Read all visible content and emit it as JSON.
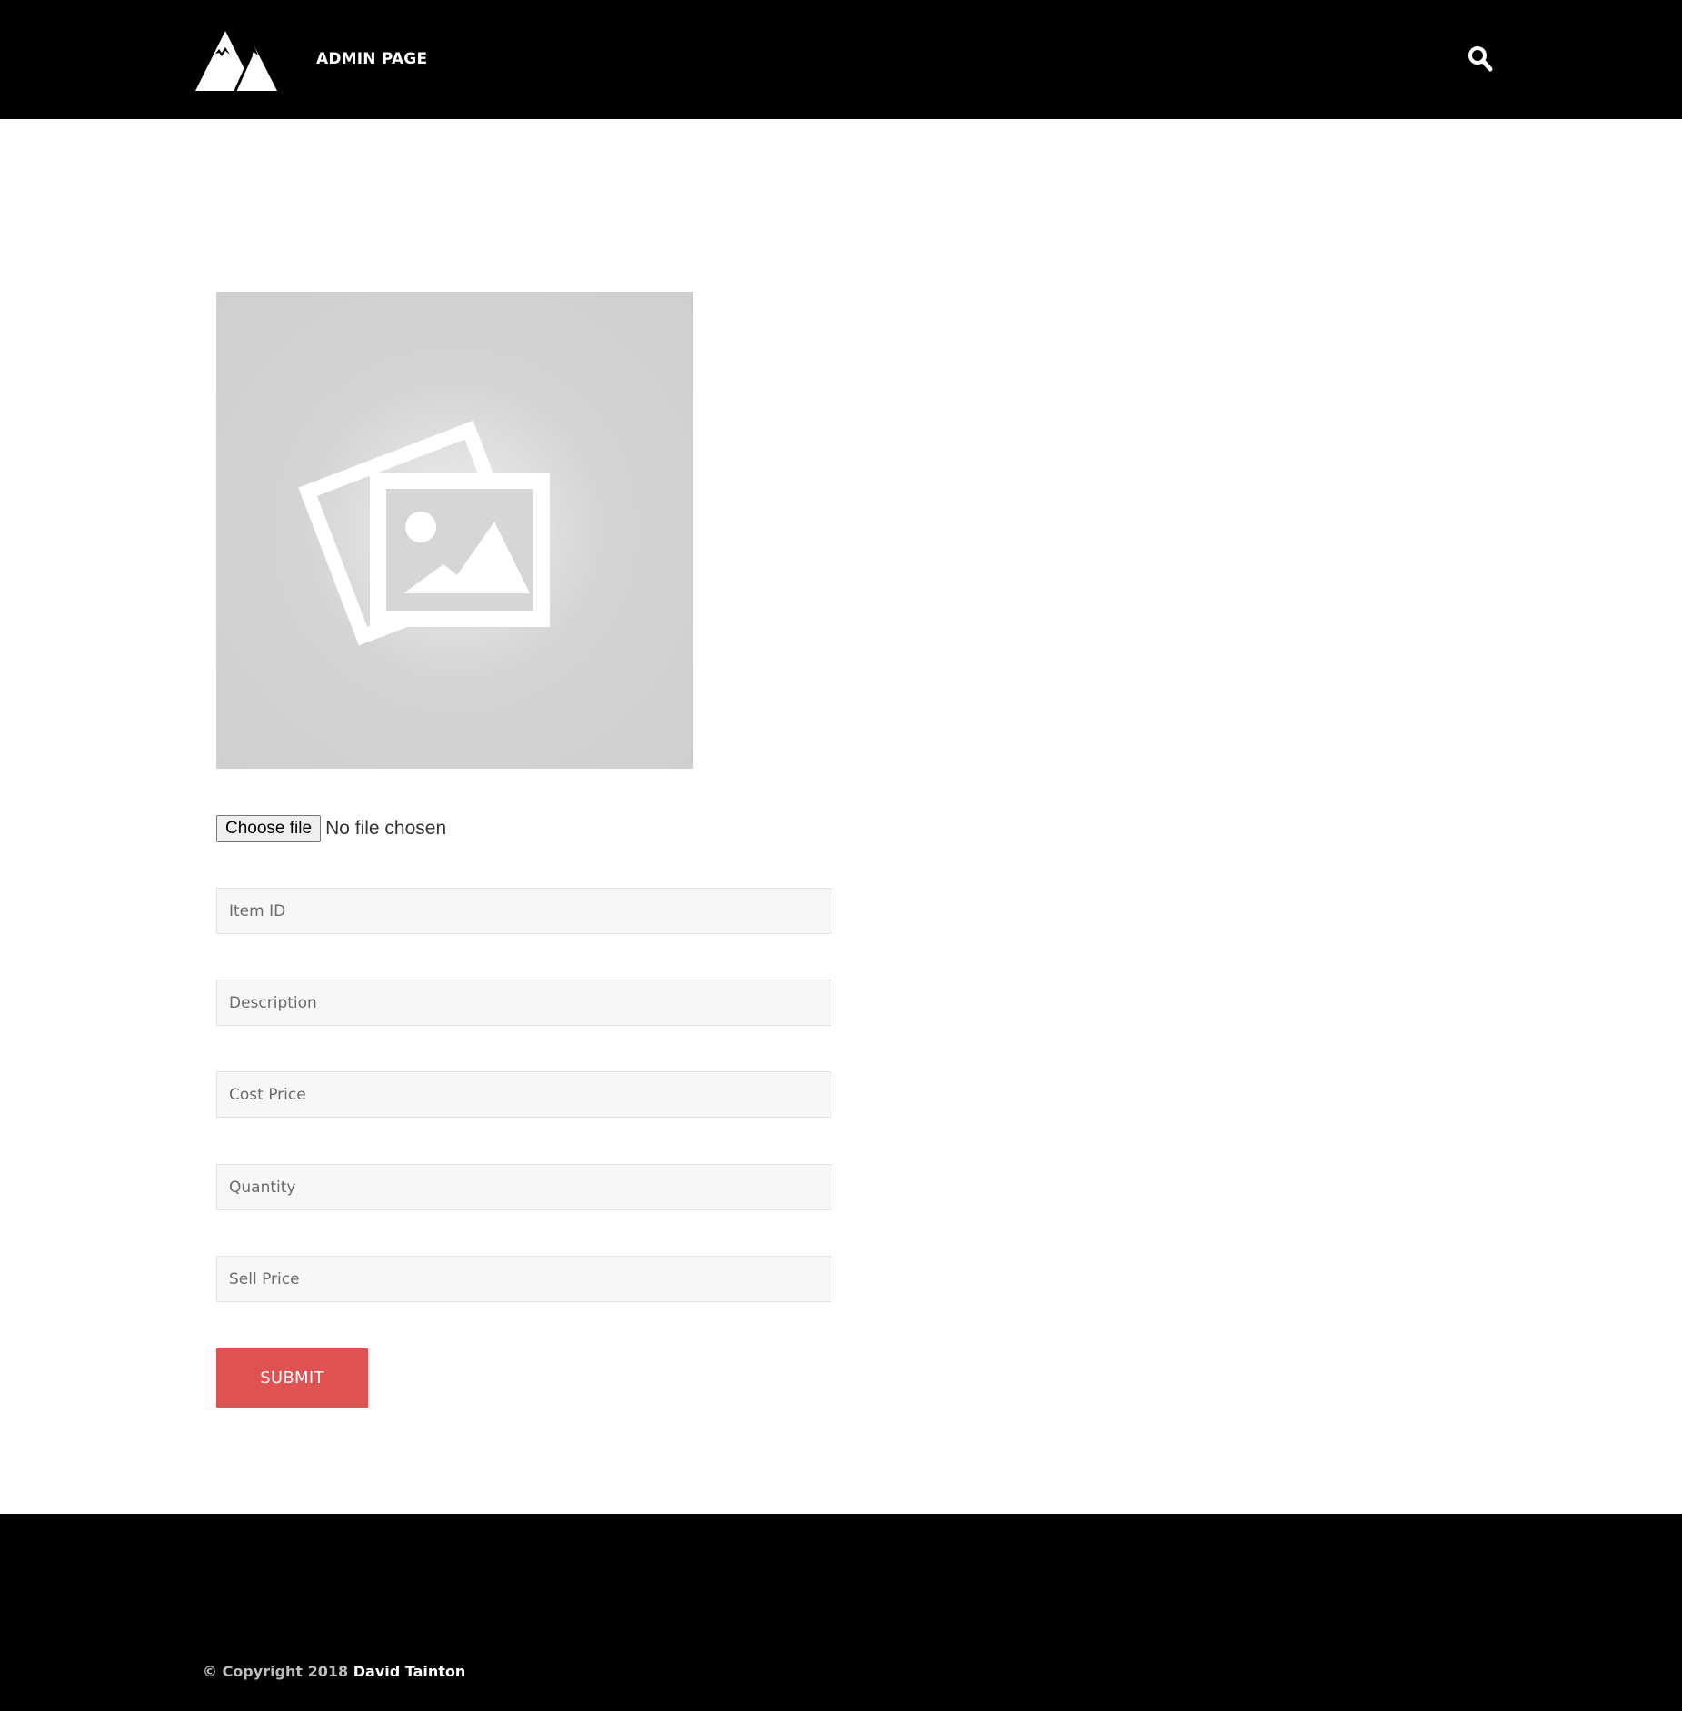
{
  "header": {
    "nav_label": "ADMIN PAGE",
    "logo_icon": "mountain-logo-icon",
    "search_icon": "search-icon"
  },
  "upload": {
    "placeholder_icon": "image-placeholder-icon",
    "choose_file_label": "Choose file",
    "file_status": "No file chosen"
  },
  "form": {
    "item_id_placeholder": "Item ID",
    "description_placeholder": "Description",
    "cost_price_placeholder": "Cost Price",
    "quantity_placeholder": "Quantity",
    "sell_price_placeholder": "Sell Price",
    "submit_label": "SUBMIT"
  },
  "footer": {
    "copyright_prefix": "© Copyright 2018",
    "author": "David Tainton"
  },
  "colors": {
    "header_bg": "#000000",
    "footer_bg": "#000000",
    "accent": "#e05252",
    "field_bg": "#f7f7f7"
  }
}
